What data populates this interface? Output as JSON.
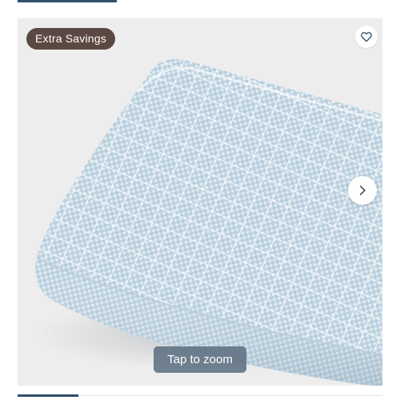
{
  "badge": {
    "label": "Extra Savings"
  },
  "favorite": {
    "icon": "heart-outline-icon",
    "color": "#2f4f6f"
  },
  "carousel": {
    "next_icon": "chevron-right-icon"
  },
  "zoom": {
    "label": "Tap to zoom"
  },
  "product": {
    "colors": {
      "fabric": "#d6e4ee",
      "check": "#9db9cd",
      "background": "#ededed"
    }
  }
}
